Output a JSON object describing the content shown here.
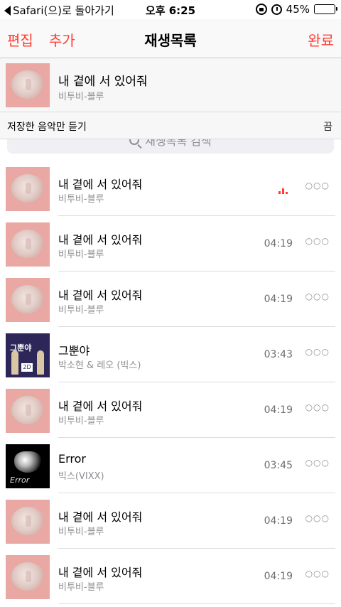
{
  "status_bar": {
    "back_label": "Safari(으)로 돌아가기",
    "time": "오후 6:25",
    "battery": "45%",
    "battery_level": 0.45
  },
  "nav": {
    "edit": "편집",
    "add": "추가",
    "title": "재생목록",
    "done": "완료"
  },
  "now_playing": {
    "title": "내 곁에 서 있어줘",
    "artist": "비투비-블루",
    "art": "pink-cloud"
  },
  "saved_only": {
    "label": "저장한 음악만 듣기",
    "state": "끔"
  },
  "search": {
    "placeholder": "재생목록 검색"
  },
  "tracks": [
    {
      "title": "내 곁에 서 있어줘",
      "artist": "비투비-블루",
      "duration": "",
      "art": "pink-cloud",
      "playing": true
    },
    {
      "title": "내 곁에 서 있어줘",
      "artist": "비투비-블루",
      "duration": "04:19",
      "art": "pink-cloud"
    },
    {
      "title": "내 곁에 서 있어줘",
      "artist": "비투비-블루",
      "duration": "04:19",
      "art": "pink-cloud"
    },
    {
      "title": "그뿐야",
      "artist": "박소현 & 레오 (빅스)",
      "duration": "03:43",
      "art": "purple-illustration",
      "art_text": "그뿐야",
      "art_badge": "2D"
    },
    {
      "title": "내 곁에 서 있어줘",
      "artist": "비투비-블루",
      "duration": "04:19",
      "art": "pink-cloud"
    },
    {
      "title": "Error",
      "artist": "빅스(VIXX)",
      "duration": "03:45",
      "art": "black-heart",
      "art_text": "Error"
    },
    {
      "title": "내 곁에 서 있어줘",
      "artist": "비투비-블루",
      "duration": "04:19",
      "art": "pink-cloud"
    },
    {
      "title": "내 곁에 서 있어줘",
      "artist": "비투비-블루",
      "duration": "04:19",
      "art": "pink-cloud"
    }
  ],
  "more_glyph": "○○○",
  "colors": {
    "accent": "#ff3b30",
    "secondary_text": "#8e8e93",
    "separator": "#dcdcdc"
  }
}
